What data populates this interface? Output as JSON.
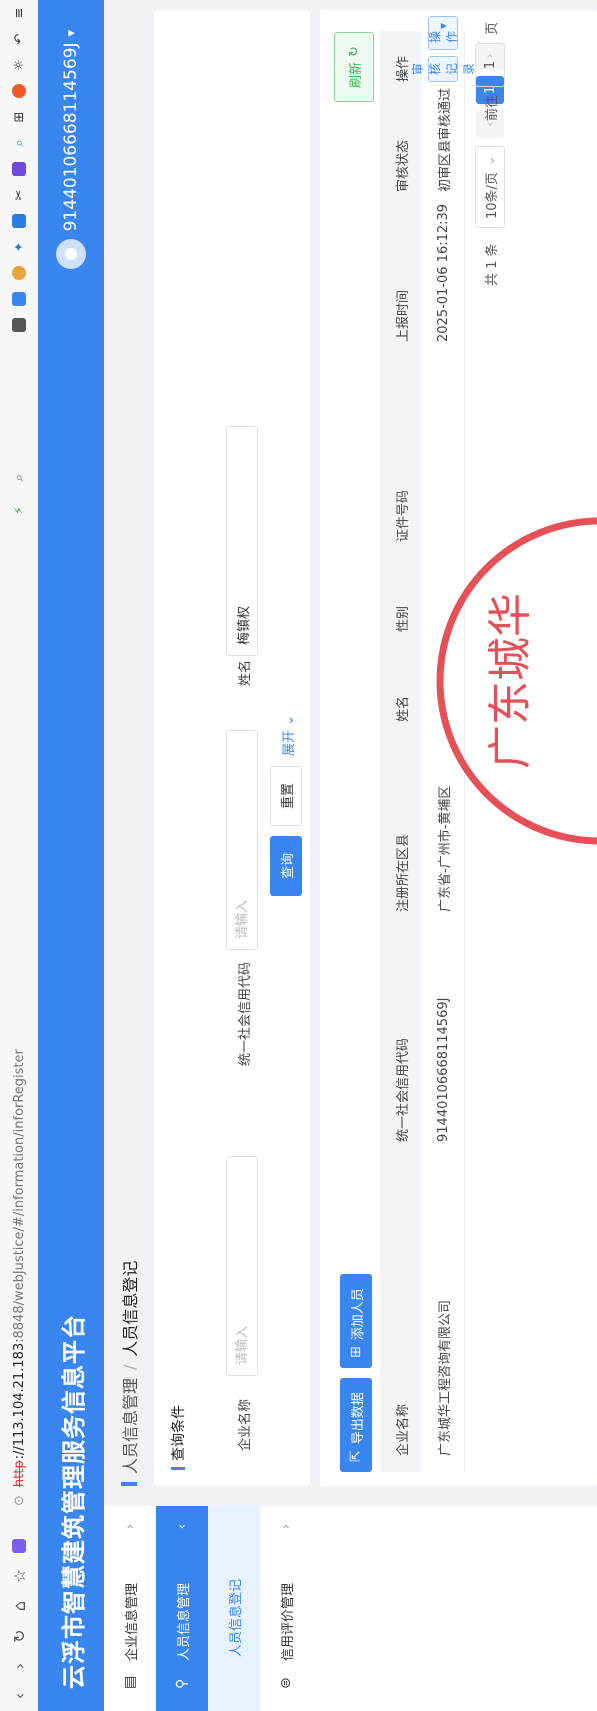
{
  "browser": {
    "url_scheme": "http",
    "url_host": "://113.104.21.183",
    "url_path": ":8848/webJustice/#/information/inforRegister",
    "nav_icons": [
      "back-icon",
      "forward-icon",
      "reload-icon",
      "home-icon",
      "star-icon",
      "ai-icon"
    ],
    "ext_icons": [
      "menu-icon",
      "undo-icon",
      "brightness-icon",
      "colorful-icon",
      "grid-icon",
      "search-icon",
      "translate-icon",
      "scissors-icon",
      "mail-icon",
      "bird-icon",
      "browser-icon",
      "cloud-icon",
      "book-icon"
    ]
  },
  "header": {
    "title": "云浮市智慧建筑管理服务信息平台",
    "user": "91440106668114569J",
    "user_caret": "▾",
    "brand_color": "#3a86f0"
  },
  "sidebar": {
    "items": [
      {
        "label": "企业信息管理",
        "icon": "building-icon",
        "chevron": "›"
      },
      {
        "label": "人员信息管理",
        "icon": "person-icon",
        "chevron": "‹"
      },
      {
        "label": "人员信息登记"
      },
      {
        "label": "信用评价管理",
        "icon": "credit-icon",
        "chevron": "›"
      }
    ]
  },
  "breadcrumb": {
    "parent": "人员信息管理",
    "sep": "/",
    "current": "人员信息登记"
  },
  "query": {
    "title": "查询条件",
    "company_label": "企业名称",
    "company_placeholder": "请输入",
    "credit_label": "统一社会信用代码",
    "credit_placeholder": "请输入",
    "name_label": "姓名",
    "name_value": "梅镇权",
    "search_button": "查询",
    "reset_button": "重置",
    "expand_label": "展开"
  },
  "toolbar": {
    "export_label": "导出数据",
    "add_label": "添加人员",
    "refresh_label": "刷新"
  },
  "table": {
    "columns": [
      "企业名称",
      "统一社会信用代码",
      "注册所在区县",
      "姓名",
      "性别",
      "证件号码",
      "上报时间",
      "审核状态",
      "操作"
    ],
    "rows": [
      {
        "company": "广东城华工程咨询有限公司",
        "credit_code": "91440106668114569J",
        "district": "广东省-广州市-黄埔区",
        "name": "",
        "gender": "",
        "id_number": "",
        "report_time": "2025-01-06 16:12:39",
        "status": "初审区县审核通过",
        "action_audit": "审核记录",
        "action_ops": "操作"
      }
    ]
  },
  "pagination": {
    "total_text": "共 1 条",
    "page_size": "10条/页",
    "current_page": "1",
    "goto_label": "前往",
    "goto_value": "1",
    "page_unit": "页"
  },
  "seal": {
    "color": "#e0323a"
  }
}
